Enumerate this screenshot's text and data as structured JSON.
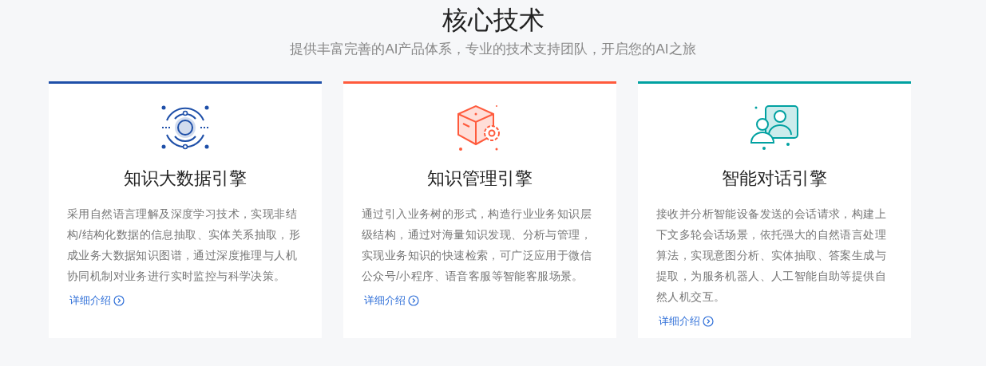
{
  "header": {
    "title": "核心技术",
    "subtitle": "提供丰富完善的AI产品体系，专业的技术支持团队，开启您的AI之旅"
  },
  "cards": [
    {
      "kind": "orbit",
      "color": "#1e4fa8",
      "title": "知识大数据引擎",
      "description": "采用自然语言理解及深度学习技术，实现非结构/结构化数据的信息抽取、实体关系抽取，形成业务大数据知识图谱，通过深度推理与人机协同机制对业务进行实时监控与科学决策。",
      "link": "详细介绍"
    },
    {
      "kind": "cube",
      "color": "#ff5a3c",
      "title": "知识管理引擎",
      "description": "通过引入业务树的形式，构造行业业务知识层级结构，通过对海量知识发现、分析与管理，实现业务知识的快速检索，可广泛应用于微信公众号/小程序、语音客服等智能客服场景。",
      "link": "详细介绍"
    },
    {
      "kind": "people",
      "color": "#00a1a1",
      "title": "智能对话引擎",
      "description": "接收并分析智能设备发送的会话请求，构建上下文多轮会话场景，依托强大的自然语言处理算法，实现意图分析、实体抽取、答案生成与提取，为服务机器人、人工智能自助等提供自然人机交互。",
      "link": "详细介绍"
    }
  ]
}
